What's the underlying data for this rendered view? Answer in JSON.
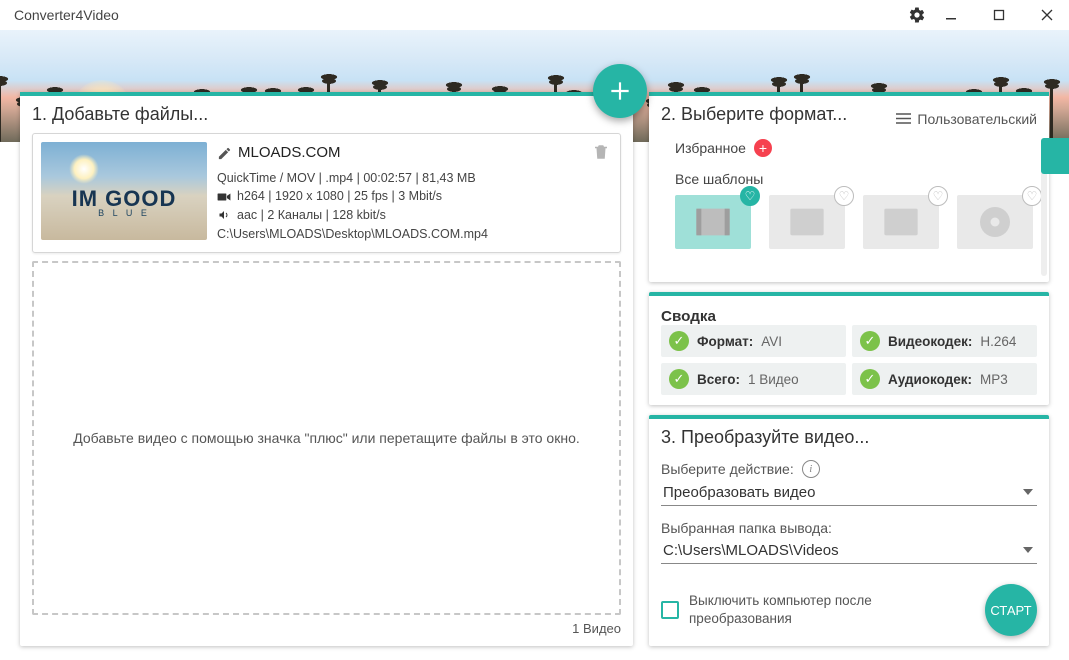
{
  "window": {
    "title": "Converter4Video"
  },
  "banner": {
    "thumb_text1": "IM GOOD",
    "thumb_text2": "B L U E"
  },
  "step1": {
    "title": "1. Добавьте файлы...",
    "file": {
      "name": "MLOADS.COM",
      "format_line": "QuickTime / MOV | .mp4 | 00:02:57 | 81,43 MB",
      "video_line": "h264 | 1920 x 1080 | 25 fps | 3 Mbit/s",
      "audio_line": "aac | 2 Каналы | 128 kbit/s",
      "path": "C:\\Users\\MLOADS\\Desktop\\MLOADS.COM.mp4"
    },
    "drop_hint": "Добавьте видео с помощью значка \"плюс\" или перетащите файлы в это окно.",
    "count": "1 Видео"
  },
  "step2": {
    "title": "2. Выберите формат...",
    "custom": "Пользовательский",
    "favorites": "Избранное",
    "all_templates": "Все шаблоны"
  },
  "summary": {
    "title": "Сводка",
    "cells": {
      "format_label": "Формат:",
      "format_value": "AVI",
      "vcodec_label": "Видеокодек:",
      "vcodec_value": "H.264",
      "total_label": "Всего:",
      "total_value": "1 Видео",
      "acodec_label": "Аудиокодек:",
      "acodec_value": "MP3"
    }
  },
  "step3": {
    "title": "3. Преобразуйте видео...",
    "action_label": "Выберите действие:",
    "action_value": "Преобразовать видео",
    "output_label": "Выбранная папка вывода:",
    "output_value": "C:\\Users\\MLOADS\\Videos",
    "shutdown": "Выключить компьютер после преобразования",
    "start": "СТАРТ"
  }
}
